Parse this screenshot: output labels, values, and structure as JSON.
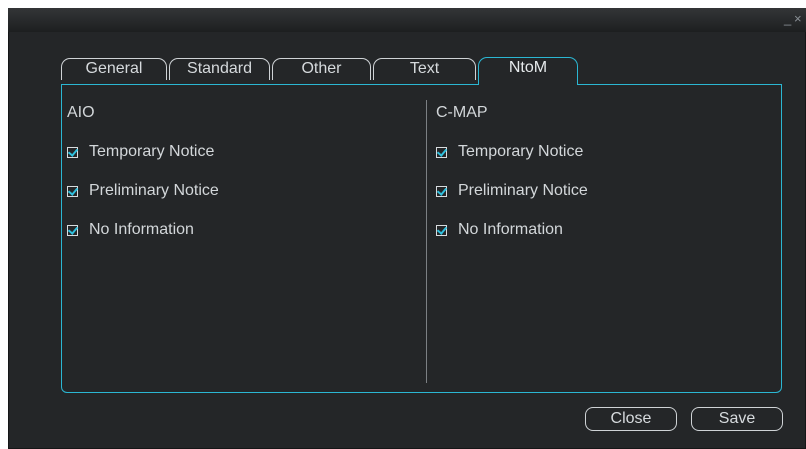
{
  "window": {
    "minimize": "_",
    "close": "×"
  },
  "tabs": [
    {
      "label": "General"
    },
    {
      "label": "Standard"
    },
    {
      "label": "Other"
    },
    {
      "label": "Text"
    },
    {
      "label": "NtoM",
      "active": true
    }
  ],
  "columns": [
    {
      "title": "AIO",
      "options": [
        {
          "label": "Temporary Notice",
          "checked": true
        },
        {
          "label": "Preliminary Notice",
          "checked": true
        },
        {
          "label": "No Information",
          "checked": true
        }
      ]
    },
    {
      "title": "C-MAP",
      "options": [
        {
          "label": "Temporary Notice",
          "checked": true
        },
        {
          "label": "Preliminary Notice",
          "checked": true
        },
        {
          "label": "No Information",
          "checked": true
        }
      ]
    }
  ],
  "buttons": {
    "close": "Close",
    "save": "Save"
  },
  "colors": {
    "accent": "#2bb7d3",
    "background": "#242628"
  }
}
